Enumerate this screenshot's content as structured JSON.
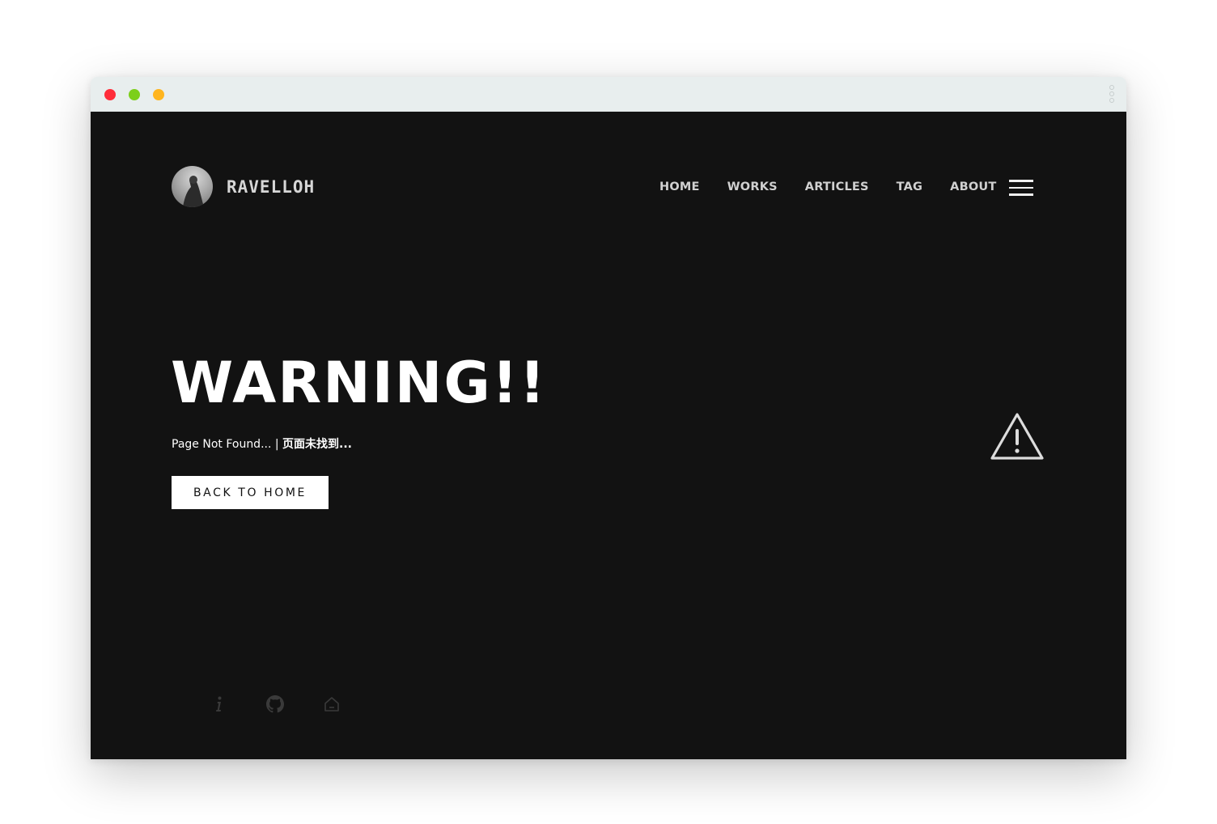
{
  "colors": {
    "page_background": "#121212",
    "titlebar_background": "#e8eeee",
    "close_dot": "#ff2d3a",
    "minimize_dot": "#7ccf1a",
    "maximize_dot": "#ffb51e",
    "nav_text": "#d0d0d0",
    "button_background": "#ffffff",
    "social_icon": "#3a3a3a"
  },
  "window": {
    "controls": [
      "close-dot",
      "minimize-dot",
      "maximize-dot"
    ],
    "menu_icon": "kebab-icon"
  },
  "header": {
    "avatar_icon": "avatar",
    "brand": "RAVELLOH",
    "nav": [
      "HOME",
      "WORKS",
      "ARTICLES",
      "TAG",
      "ABOUT"
    ],
    "menu_icon": "hamburger-icon"
  },
  "hero": {
    "title": "WARNING!!",
    "subtitle_en": "Page Not Found... | ",
    "subtitle_cn": "页面未找到...",
    "button_label": "BACK TO HOME",
    "illustration_icon": "warning-triangle-icon"
  },
  "footer": {
    "social_icons": [
      "info-icon",
      "github-icon",
      "home-icon"
    ]
  }
}
